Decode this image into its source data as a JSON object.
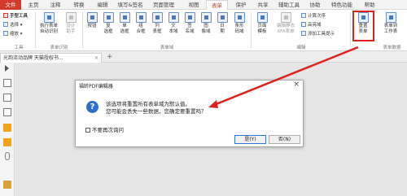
{
  "menubar": {
    "file": "文件",
    "items": [
      {
        "label": "主页"
      },
      {
        "label": "注释"
      },
      {
        "label": "转换"
      },
      {
        "label": "编辑"
      },
      {
        "label": "填写&签名"
      },
      {
        "label": "页面管理"
      },
      {
        "label": "视图"
      },
      {
        "label": "表单"
      },
      {
        "label": "保护"
      },
      {
        "label": "共享"
      },
      {
        "label": "辅助工具"
      },
      {
        "label": "协助"
      },
      {
        "label": "特色功能"
      },
      {
        "label": "帮助"
      }
    ]
  },
  "ribbon": {
    "tool_group": {
      "hand": "手型工具",
      "select": "选择",
      "zoom": "缩放",
      "label": "工具"
    },
    "run_js": "执行表单\n自动识别",
    "design_helper": "设计\n助手",
    "form_recog_label": "表单识别",
    "fields": [
      {
        "label": "按钮"
      },
      {
        "label": "复\n选框"
      },
      {
        "label": "单\n选框"
      },
      {
        "label": "组\n合框"
      },
      {
        "label": "列\n表框"
      },
      {
        "label": "文\n本域"
      },
      {
        "label": "签\n名域"
      },
      {
        "label": "图\n像域"
      },
      {
        "label": "日\n期"
      },
      {
        "label": "条形\n码域"
      }
    ],
    "form_fields_label": "表单域",
    "page_template": "页面\n模板",
    "edit_xfa": "编辑静态\nXFA表单",
    "calc_order": "计算次序",
    "highlight": "高亮域",
    "add_tooltip": "添加工具提示",
    "edit_label": "编辑",
    "reset_form": "重置\n表单",
    "form_to_sheet": "表单到\n工作表",
    "form_data_label": "表单数据"
  },
  "tabbar": {
    "doc_tab": "光韵流动品牌 天猫授权书...",
    "close": "×",
    "plus": "+"
  },
  "dialog": {
    "title": "福昕PDF编辑器",
    "close": "×",
    "icon": "?",
    "message1": "该选项将重置所有表单域为默认值。",
    "message2": "您可能会丢失一些数据，您确定要重置吗？",
    "checkbox_label": "不要再次询问",
    "yes": "是(Y)",
    "no": "否(N)"
  },
  "colors": {
    "accent": "#d33a2c",
    "highlight": "#e0201b",
    "arrow": "#e0201b"
  }
}
